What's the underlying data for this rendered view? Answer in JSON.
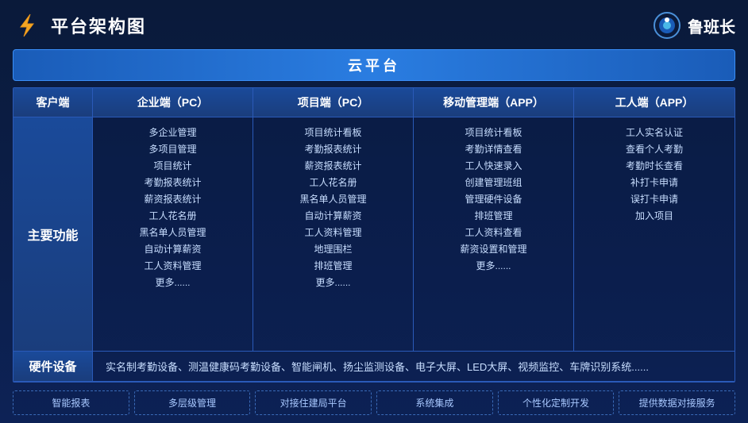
{
  "header": {
    "title": "平台架构图",
    "brand": "鲁班长"
  },
  "cloud_bar": "云平台",
  "col_headers": {
    "col0": "客户端",
    "col1": "企业端（PC）",
    "col2": "项目端（PC）",
    "col3": "移动管理端（APP）",
    "col4": "工人端（APP）"
  },
  "main_label": "主要功能",
  "enterprise_features": [
    "多企业管理",
    "多项目管理",
    "项目统计",
    "考勤报表统计",
    "薪资报表统计",
    "工人花名册",
    "黑名单人员管理",
    "自动计算薪资",
    "工人资料管理",
    "更多......"
  ],
  "project_features": [
    "项目统计看板",
    "考勤报表统计",
    "薪资报表统计",
    "工人花名册",
    "黑名单人员管理",
    "自动计算薪资",
    "工人资料管理",
    "地理围栏",
    "排班管理",
    "更多......"
  ],
  "mobile_features": [
    "项目统计看板",
    "考勤详情查看",
    "工人快速录入",
    "创建管理班组",
    "管理硬件设备",
    "排班管理",
    "工人资料查看",
    "薪资设置和管理",
    "更多......"
  ],
  "worker_features": [
    "工人实名认证",
    "查看个人考勤",
    "考勤时长查看",
    "补打卡申请",
    "误打卡申请",
    "加入项目"
  ],
  "hardware_label": "硬件设备",
  "hardware_content": "实名制考勤设备、测温健康码考勤设备、智能闸机、扬尘监测设备、电子大屏、LED大屏、视频监控、车牌识别系统......",
  "tags": [
    "智能报表",
    "多层级管理",
    "对接住建局平台",
    "系统集成",
    "个性化定制开发",
    "提供数据对接服务"
  ]
}
